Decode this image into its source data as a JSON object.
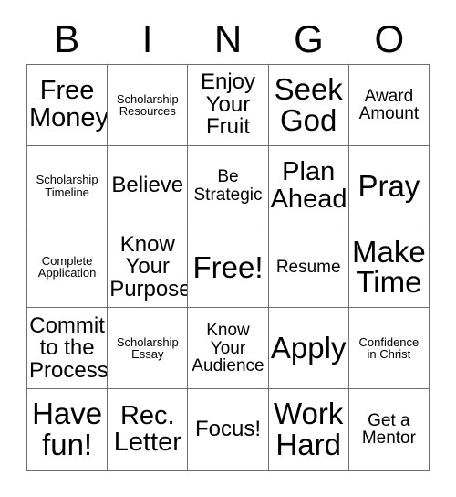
{
  "card": {
    "type": "bingo-card",
    "columns": 5,
    "rows": 5,
    "background_color": "#ffffff",
    "text_color": "#000000",
    "border_color": "#6e6e6e"
  },
  "header": {
    "letters": [
      "B",
      "I",
      "N",
      "G",
      "O"
    ]
  },
  "grid": {
    "rows": [
      [
        {
          "text": "Free\nMoney",
          "size": "lg"
        },
        {
          "text": "Scholarship\nResources",
          "size": "xs"
        },
        {
          "text": "Enjoy\nYour\nFruit",
          "size": "md"
        },
        {
          "text": "Seek\nGod",
          "size": "xl"
        },
        {
          "text": "Award\nAmount",
          "size": "sm"
        }
      ],
      [
        {
          "text": "Scholarship\nTimeline",
          "size": "xs"
        },
        {
          "text": "Believe",
          "size": "md"
        },
        {
          "text": "Be\nStrategic",
          "size": "sm"
        },
        {
          "text": "Plan\nAhead",
          "size": "lg"
        },
        {
          "text": "Pray",
          "size": "xl"
        }
      ],
      [
        {
          "text": "Complete\nApplication",
          "size": "xs"
        },
        {
          "text": "Know\nYour\nPurpose",
          "size": "md"
        },
        {
          "text": "Free!",
          "size": "xl"
        },
        {
          "text": "Resume",
          "size": "sm"
        },
        {
          "text": "Make\nTime",
          "size": "xl"
        }
      ],
      [
        {
          "text": "Commit\nto the\nProcess",
          "size": "md"
        },
        {
          "text": "Scholarship\nEssay",
          "size": "xs"
        },
        {
          "text": "Know\nYour\nAudience",
          "size": "sm"
        },
        {
          "text": "Apply",
          "size": "xl"
        },
        {
          "text": "Confidence\nin Christ",
          "size": "xs"
        }
      ],
      [
        {
          "text": "Have\nfun!",
          "size": "xl"
        },
        {
          "text": "Rec.\nLetter",
          "size": "lg"
        },
        {
          "text": "Focus!",
          "size": "md"
        },
        {
          "text": "Work\nHard",
          "size": "xl"
        },
        {
          "text": "Get a\nMentor",
          "size": "sm"
        }
      ]
    ]
  }
}
